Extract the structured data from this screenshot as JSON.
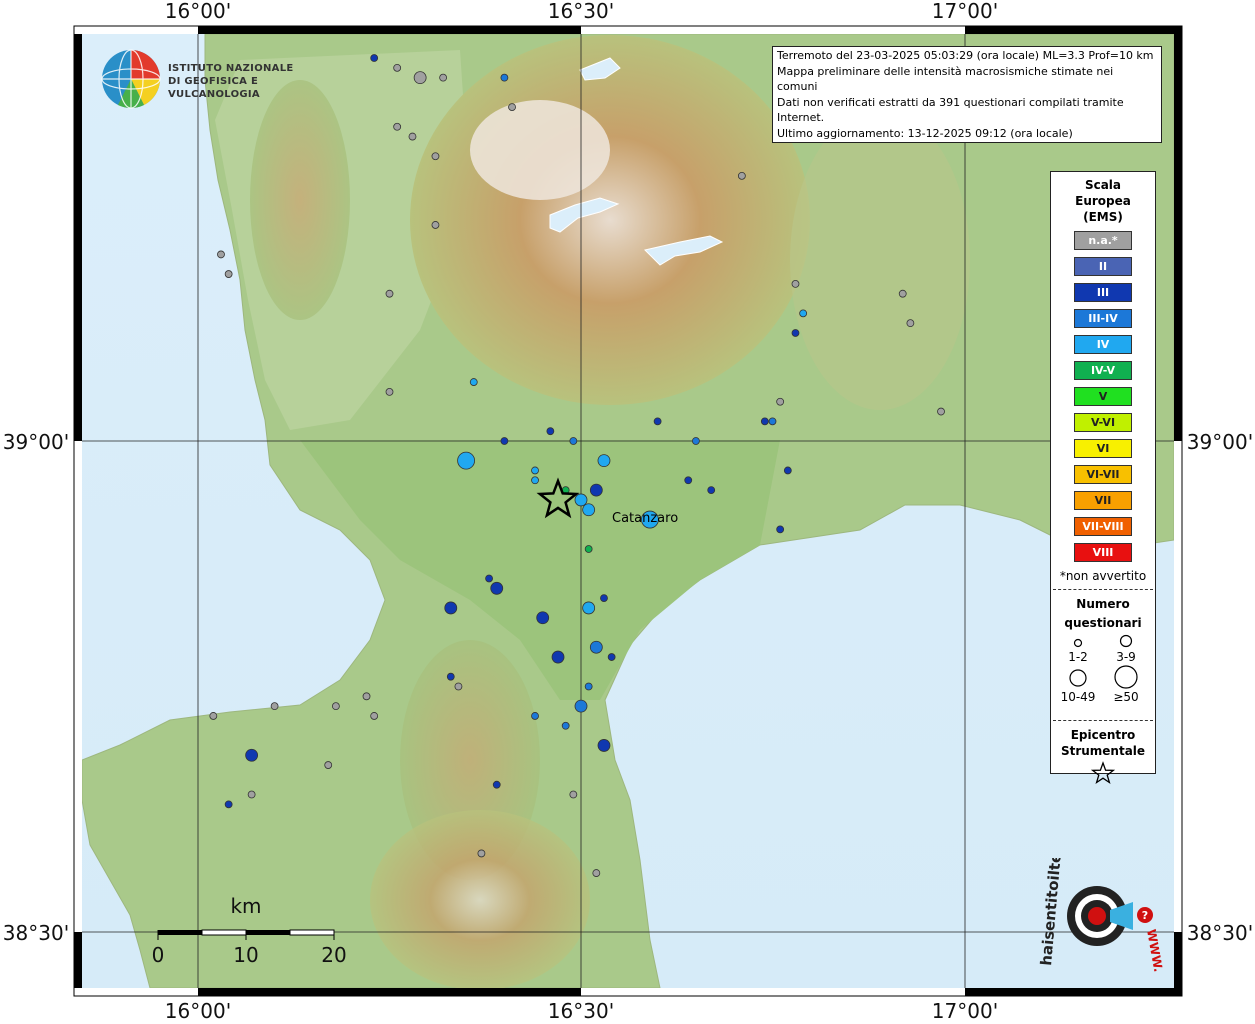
{
  "map": {
    "grid_lon_labels": [
      "16°00'",
      "16°30'",
      "17°00'"
    ],
    "grid_lat_labels": [
      "39°00'",
      "38°30'"
    ],
    "city": "Catanzaro"
  },
  "infobox": {
    "line1": "Terremoto del 23-03-2025 05:03:29 (ora locale) ML=3.3 Prof=10 km",
    "line2": "Mappa preliminare delle intensità macrosismiche stimate nei comuni",
    "line3": "Dati non verificati estratti da 391 questionari compilati tramite Internet.",
    "line4": "Ultimo aggiornamento: 13-12-2025 09:12 (ora locale)"
  },
  "logo_ingv": {
    "line1": "ISTITUTO NAZIONALE",
    "line2": "DI GEOFISICA E VULCANOLOGIA"
  },
  "logo_hsit": {
    "text": "haisentitoilterremoto.it",
    "url_text": "WWW."
  },
  "legend": {
    "title1": "Scala",
    "title2": "Europea",
    "title3": "(EMS)",
    "classes": [
      {
        "label": "n.a.*",
        "color": "#a0a0a0"
      },
      {
        "label": "II",
        "color": "#4a64b4"
      },
      {
        "label": "III",
        "color": "#1038b0"
      },
      {
        "label": "III-IV",
        "color": "#1c78d8"
      },
      {
        "label": "IV",
        "color": "#20a8f0"
      },
      {
        "label": "IV-V",
        "color": "#10b050"
      },
      {
        "label": "V",
        "color": "#20e020"
      },
      {
        "label": "V-VI",
        "color": "#c0f000"
      },
      {
        "label": "VI",
        "color": "#f8f000"
      },
      {
        "label": "VI-VII",
        "color": "#f8c000"
      },
      {
        "label": "VII",
        "color": "#f8a000"
      },
      {
        "label": "VII-VIII",
        "color": "#f06000"
      },
      {
        "label": "VIII",
        "color": "#e81010"
      }
    ],
    "not_felt_note": "*non avvertito",
    "questionnaire_title1": "Numero",
    "questionnaire_title2": "questionari",
    "size_labels": [
      "1-2",
      "3-9",
      "10-49",
      "≥50"
    ],
    "epicenter_title1": "Epicentro",
    "epicenter_title2": "Strumentale"
  },
  "scalebar": {
    "unit": "km",
    "ticks": [
      "0",
      "10",
      "20"
    ]
  },
  "points": [
    {
      "lon": 16.23,
      "lat": 39.39,
      "class": 2,
      "n": 1
    },
    {
      "lon": 16.26,
      "lat": 39.38,
      "class": 0,
      "n": 1
    },
    {
      "lon": 16.29,
      "lat": 39.37,
      "class": 0,
      "n": 3
    },
    {
      "lon": 16.32,
      "lat": 39.37,
      "class": 0,
      "n": 1
    },
    {
      "lon": 16.4,
      "lat": 39.37,
      "class": 3,
      "n": 2
    },
    {
      "lon": 16.41,
      "lat": 39.34,
      "class": 0,
      "n": 1
    },
    {
      "lon": 16.26,
      "lat": 39.32,
      "class": 0,
      "n": 1
    },
    {
      "lon": 16.28,
      "lat": 39.31,
      "class": 0,
      "n": 1
    },
    {
      "lon": 16.31,
      "lat": 39.29,
      "class": 0,
      "n": 1
    },
    {
      "lon": 16.31,
      "lat": 39.22,
      "class": 0,
      "n": 1
    },
    {
      "lon": 16.04,
      "lat": 39.17,
      "class": 0,
      "n": 1
    },
    {
      "lon": 16.03,
      "lat": 39.19,
      "class": 0,
      "n": 1
    },
    {
      "lon": 16.25,
      "lat": 39.15,
      "class": 0,
      "n": 1
    },
    {
      "lon": 16.25,
      "lat": 39.05,
      "class": 0,
      "n": 1
    },
    {
      "lon": 16.36,
      "lat": 39.06,
      "class": 4,
      "n": 2
    },
    {
      "lon": 16.4,
      "lat": 39.0,
      "class": 2,
      "n": 1
    },
    {
      "lon": 16.46,
      "lat": 39.01,
      "class": 2,
      "n": 2
    },
    {
      "lon": 16.49,
      "lat": 39.0,
      "class": 3,
      "n": 1
    },
    {
      "lon": 16.35,
      "lat": 38.98,
      "class": 4,
      "n": 20
    },
    {
      "lon": 16.44,
      "lat": 38.97,
      "class": 4,
      "n": 2
    },
    {
      "lon": 16.44,
      "lat": 38.96,
      "class": 4,
      "n": 2
    },
    {
      "lon": 16.48,
      "lat": 38.95,
      "class": 5,
      "n": 1
    },
    {
      "lon": 16.5,
      "lat": 38.94,
      "class": 4,
      "n": 3
    },
    {
      "lon": 16.52,
      "lat": 38.95,
      "class": 2,
      "n": 3
    },
    {
      "lon": 16.53,
      "lat": 38.98,
      "class": 4,
      "n": 3
    },
    {
      "lon": 16.51,
      "lat": 38.93,
      "class": 4,
      "n": 5
    },
    {
      "lon": 16.59,
      "lat": 38.92,
      "class": 4,
      "n": 20
    },
    {
      "lon": 16.6,
      "lat": 39.02,
      "class": 2,
      "n": 2
    },
    {
      "lon": 16.65,
      "lat": 39.0,
      "class": 3,
      "n": 1
    },
    {
      "lon": 16.64,
      "lat": 38.96,
      "class": 2,
      "n": 2
    },
    {
      "lon": 16.67,
      "lat": 38.95,
      "class": 2,
      "n": 1
    },
    {
      "lon": 16.76,
      "lat": 38.91,
      "class": 2,
      "n": 2
    },
    {
      "lon": 16.77,
      "lat": 38.97,
      "class": 2,
      "n": 1
    },
    {
      "lon": 16.74,
      "lat": 39.02,
      "class": 2,
      "n": 1
    },
    {
      "lon": 16.75,
      "lat": 39.02,
      "class": 3,
      "n": 1
    },
    {
      "lon": 16.76,
      "lat": 39.04,
      "class": 0,
      "n": 1
    },
    {
      "lon": 16.78,
      "lat": 39.11,
      "class": 2,
      "n": 1
    },
    {
      "lon": 16.79,
      "lat": 39.13,
      "class": 4,
      "n": 1
    },
    {
      "lon": 16.78,
      "lat": 39.16,
      "class": 0,
      "n": 1
    },
    {
      "lon": 16.92,
      "lat": 39.15,
      "class": 0,
      "n": 1
    },
    {
      "lon": 16.93,
      "lat": 39.12,
      "class": 0,
      "n": 1
    },
    {
      "lon": 16.97,
      "lat": 39.03,
      "class": 0,
      "n": 1
    },
    {
      "lon": 17.02,
      "lat": 39.37,
      "class": 0,
      "n": 1
    },
    {
      "lon": 16.71,
      "lat": 39.27,
      "class": 0,
      "n": 1
    },
    {
      "lon": 16.51,
      "lat": 38.89,
      "class": 5,
      "n": 1
    },
    {
      "lon": 16.38,
      "lat": 38.86,
      "class": 2,
      "n": 1
    },
    {
      "lon": 16.39,
      "lat": 38.85,
      "class": 2,
      "n": 3
    },
    {
      "lon": 16.33,
      "lat": 38.83,
      "class": 2,
      "n": 3
    },
    {
      "lon": 16.45,
      "lat": 38.82,
      "class": 2,
      "n": 3
    },
    {
      "lon": 16.51,
      "lat": 38.83,
      "class": 4,
      "n": 5
    },
    {
      "lon": 16.53,
      "lat": 38.84,
      "class": 2,
      "n": 1
    },
    {
      "lon": 16.47,
      "lat": 38.78,
      "class": 2,
      "n": 3
    },
    {
      "lon": 16.52,
      "lat": 38.79,
      "class": 3,
      "n": 3
    },
    {
      "lon": 16.54,
      "lat": 38.78,
      "class": 2,
      "n": 1
    },
    {
      "lon": 16.33,
      "lat": 38.76,
      "class": 2,
      "n": 1
    },
    {
      "lon": 16.34,
      "lat": 38.75,
      "class": 0,
      "n": 1
    },
    {
      "lon": 16.51,
      "lat": 38.75,
      "class": 3,
      "n": 1
    },
    {
      "lon": 16.5,
      "lat": 38.73,
      "class": 3,
      "n": 3
    },
    {
      "lon": 16.44,
      "lat": 38.72,
      "class": 3,
      "n": 1
    },
    {
      "lon": 16.48,
      "lat": 38.71,
      "class": 3,
      "n": 1
    },
    {
      "lon": 16.53,
      "lat": 38.69,
      "class": 2,
      "n": 3
    },
    {
      "lon": 16.22,
      "lat": 38.74,
      "class": 0,
      "n": 1
    },
    {
      "lon": 16.18,
      "lat": 38.73,
      "class": 0,
      "n": 1
    },
    {
      "lon": 16.07,
      "lat": 38.68,
      "class": 2,
      "n": 3
    },
    {
      "lon": 16.07,
      "lat": 38.64,
      "class": 0,
      "n": 1
    },
    {
      "lon": 16.04,
      "lat": 38.63,
      "class": 2,
      "n": 1
    },
    {
      "lon": 16.17,
      "lat": 38.67,
      "class": 0,
      "n": 1
    },
    {
      "lon": 16.23,
      "lat": 38.72,
      "class": 0,
      "n": 1
    },
    {
      "lon": 16.39,
      "lat": 38.65,
      "class": 2,
      "n": 1
    },
    {
      "lon": 16.49,
      "lat": 38.64,
      "class": 0,
      "n": 1
    },
    {
      "lon": 16.37,
      "lat": 38.58,
      "class": 0,
      "n": 1
    },
    {
      "lon": 16.52,
      "lat": 38.56,
      "class": 0,
      "n": 1
    },
    {
      "lon": 16.02,
      "lat": 38.72,
      "class": 0,
      "n": 1
    },
    {
      "lon": 16.1,
      "lat": 38.73,
      "class": 0,
      "n": 1
    }
  ],
  "epicenter": {
    "lon": 16.47,
    "lat": 38.94
  }
}
